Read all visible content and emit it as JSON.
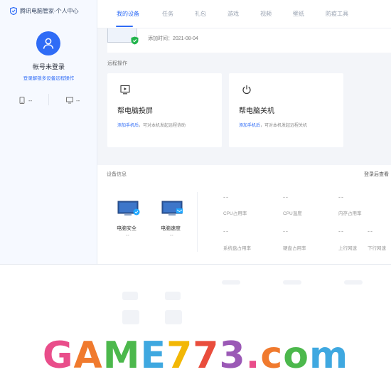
{
  "brand": {
    "title": "腾讯电脑管家-个人中心"
  },
  "user": {
    "status": "帐号未登录",
    "hint": "登录解锁多设备远程操作",
    "stat_left": "--",
    "stat_right": "--"
  },
  "nav": {
    "tabs": [
      {
        "label": "我的设备",
        "active": true
      },
      {
        "label": "任务"
      },
      {
        "label": "礼包"
      },
      {
        "label": "游戏"
      },
      {
        "label": "视频"
      },
      {
        "label": "壁纸"
      },
      {
        "label": "防疫工具"
      }
    ]
  },
  "device": {
    "added_time": "添加时间：2021-08-04"
  },
  "remote": {
    "section_title": "远程操作",
    "cards": [
      {
        "title": "帮电脑投屏",
        "desc_link": "添加手机后",
        "desc_rest": "，可对本机发起远程协助",
        "icon": "screen-cast-icon"
      },
      {
        "title": "帮电脑关机",
        "desc_link": "添加手机后",
        "desc_rest": "，可对本机发起远程关机",
        "icon": "power-icon"
      }
    ]
  },
  "device_info": {
    "title": "设备信息",
    "link": "登录后查看",
    "items": [
      {
        "label": "电脑安全",
        "value": "--"
      },
      {
        "label": "电脑速度",
        "value": "--"
      }
    ],
    "metrics": [
      {
        "label": "CPU占用率",
        "value": "--"
      },
      {
        "label": "CPU温度",
        "value": "--"
      },
      {
        "label": "内存占用率",
        "value": "--"
      },
      {
        "label": "系统盘占用率",
        "value": "--"
      },
      {
        "label": "硬盘占用率",
        "value": "--"
      },
      {
        "label": "上行网速",
        "value": "--"
      },
      {
        "label": "下行网速",
        "value": "--"
      }
    ]
  },
  "watermark": {
    "text": "GAME773.com",
    "colors": [
      "#e94d8a",
      "#f07a2e",
      "#4cb84c",
      "#3fa8e0",
      "#f2b705",
      "#e94d3c",
      "#9b59b6"
    ]
  },
  "colors": {
    "accent": "#2f6cf6",
    "shield": "#22b44d"
  }
}
